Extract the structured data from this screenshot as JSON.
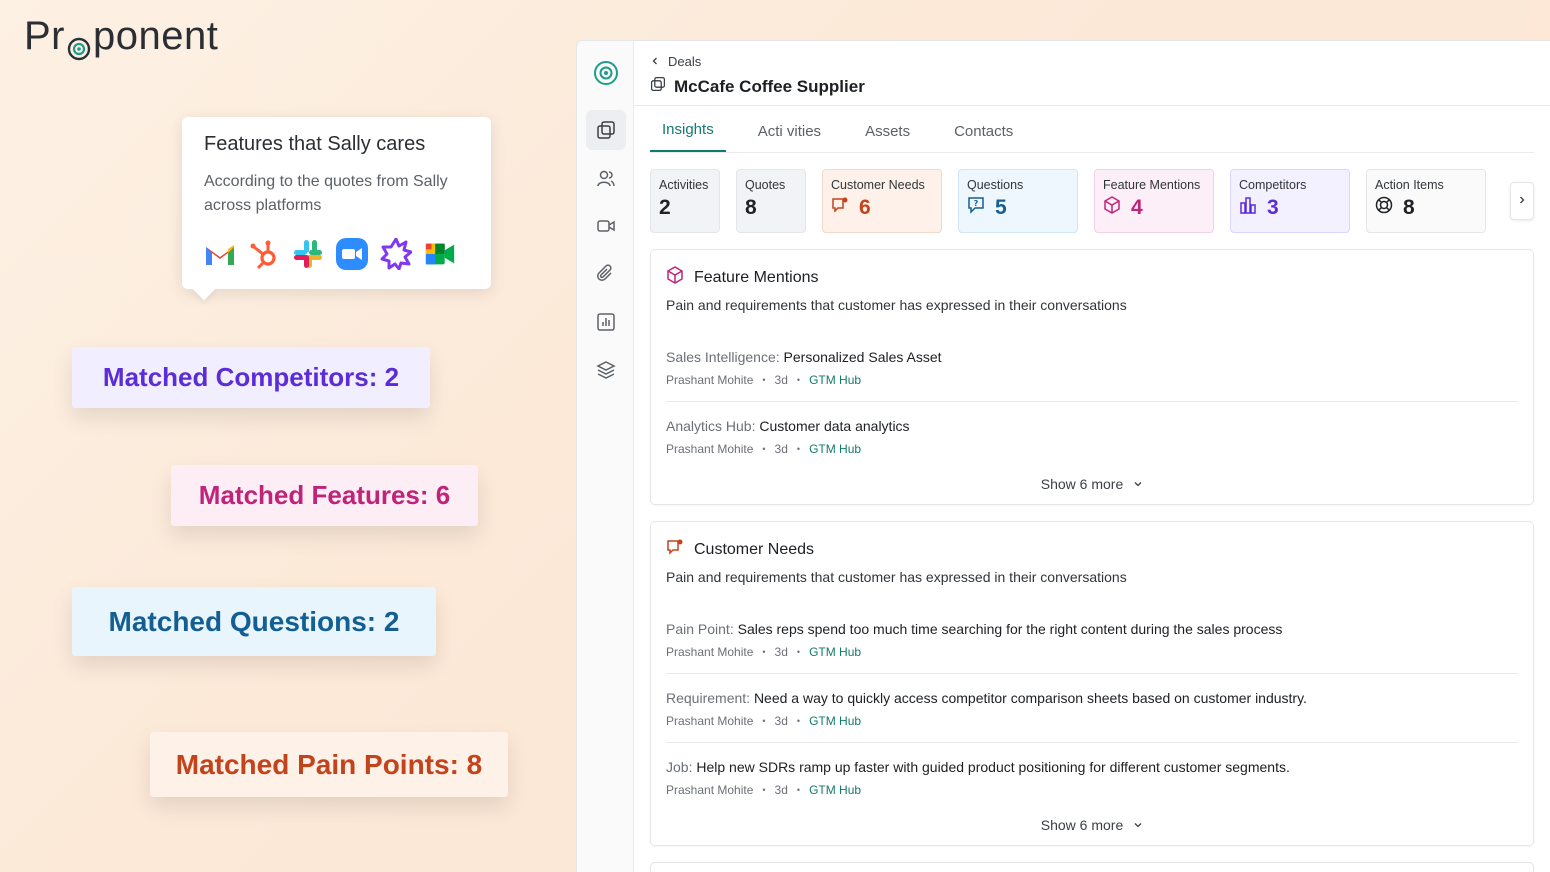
{
  "brand": {
    "name_a": "Pr",
    "name_b": "ponent"
  },
  "tooltip": {
    "title": "Features that Sally cares",
    "subtitle": "According to the quotes from Sally across platforms",
    "icons": [
      "gmail-icon",
      "hubspot-icon",
      "slack-icon",
      "zoom-icon",
      "gong-icon",
      "google-meet-icon"
    ]
  },
  "matches": {
    "competitors": "Matched Competitors: 2",
    "features": "Matched Features: 6",
    "questions": "Matched Questions: 2",
    "pain_points": "Matched Pain Points: 8"
  },
  "app": {
    "breadcrumb": "Deals",
    "title": "McCafe Coffee Supplier",
    "tabs": [
      "Insights",
      "Acti vities",
      "Assets",
      "Contacts"
    ],
    "stats": [
      {
        "label": "Activities",
        "value": "2"
      },
      {
        "label": "Quotes",
        "value": "8"
      },
      {
        "label": "Customer Needs",
        "value": "6"
      },
      {
        "label": "Questions",
        "value": "5"
      },
      {
        "label": "Feature Mentions",
        "value": "4"
      },
      {
        "label": "Competitors",
        "value": "3"
      },
      {
        "label": "Action Items",
        "value": "8"
      }
    ],
    "feature_card": {
      "title": "Feature Mentions",
      "subtitle": "Pain and requirements that customer has expressed in their conversations",
      "items": [
        {
          "key": "Sales Intelligence:",
          "text": "Personalized Sales Asset",
          "author": "Prashant Mohite",
          "time": "3d",
          "source": "GTM Hub"
        },
        {
          "key": "Analytics Hub:",
          "text": "Customer data analytics",
          "author": "Prashant Mohite",
          "time": "3d",
          "source": "GTM Hub"
        }
      ],
      "more": "Show 6 more"
    },
    "needs_card": {
      "title": "Customer Needs",
      "subtitle": "Pain and requirements that customer has expressed in their conversations",
      "items": [
        {
          "key": "Pain Point:",
          "text": "Sales reps spend too much time searching for the right content during the sales process",
          "author": "Prashant Mohite",
          "time": "3d",
          "source": "GTM Hub"
        },
        {
          "key": "Requirement:",
          "text": "Need a way to quickly access competitor comparison sheets based on customer industry.",
          "author": "Prashant Mohite",
          "time": "3d",
          "source": "GTM Hub"
        },
        {
          "key": "Job:",
          "text": "Help new SDRs ramp up faster with guided product positioning for different customer segments.",
          "author": "Prashant Mohite",
          "time": "3d",
          "source": "GTM Hub"
        }
      ],
      "more": "Show 6 more"
    }
  },
  "colors": {
    "accent": "#137a6f",
    "competitors": "#5b2cd8",
    "features": "#c0237a",
    "questions": "#135f94",
    "needs": "#c2431c"
  }
}
